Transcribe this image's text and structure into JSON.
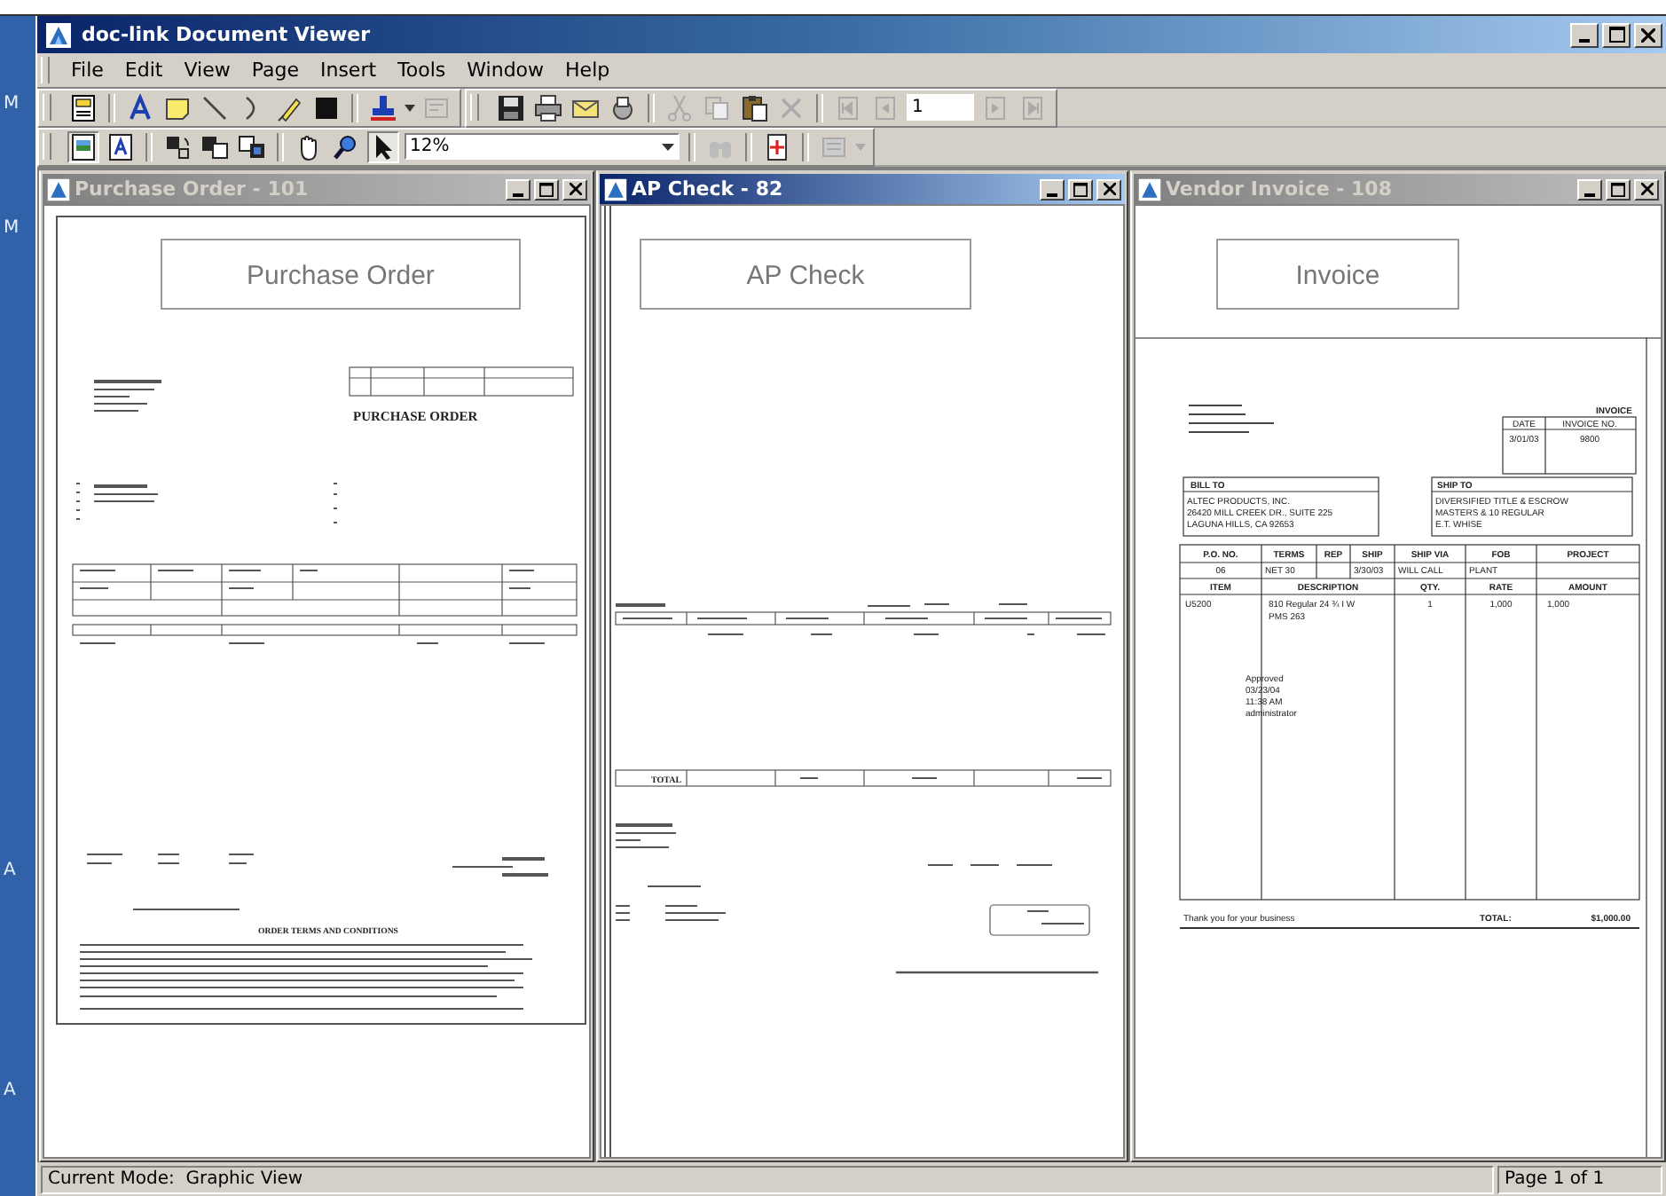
{
  "window": {
    "title": "doc-link Document Viewer"
  },
  "desktop_labels": [
    "M",
    "M",
    "A",
    "A"
  ],
  "menu": [
    "File",
    "Edit",
    "View",
    "Page",
    "Insert",
    "Tools",
    "Window",
    "Help"
  ],
  "toolbar": {
    "page_number": "1",
    "zoom": "12%"
  },
  "documents": [
    {
      "kind": "purchase_order",
      "title": "Purchase Order - 101",
      "active": false,
      "header": "Purchase Order",
      "heading": "PURCHASE ORDER",
      "terms_heading": "ORDER TERMS AND CONDITIONS"
    },
    {
      "kind": "check",
      "title": "AP Check - 82",
      "active": true,
      "header": "AP Check",
      "total_label": "TOTAL"
    },
    {
      "kind": "invoice",
      "title": "Vendor Invoice - 108",
      "active": false,
      "header": "Invoice",
      "heading": "INVOICE",
      "date_label": "DATE",
      "number_label": "INVOICE NO.",
      "date": "3/01/03",
      "number": "9800",
      "bill_to": {
        "label": "BILL TO",
        "lines": [
          "ALTEC PRODUCTS, INC.",
          "26420 MILL CREEK DR., SUITE 225",
          "LAGUNA HILLS, CA 92653"
        ]
      },
      "ship_to": {
        "label": "SHIP TO",
        "lines": [
          "DIVERSIFIED TITLE & ESCROW",
          "MASTERS & 10 REGULAR",
          "E.T. WHISE"
        ]
      },
      "terms_columns": [
        {
          "label": "P.O. NO.",
          "value": "06"
        },
        {
          "label": "TERMS",
          "value": "NET 30"
        },
        {
          "label": "REP"
        },
        {
          "label": "SHIP",
          "value": "3/30/03"
        },
        {
          "label": "SHIP VIA",
          "value": "WILL CALL"
        },
        {
          "label": "FOB",
          "value": "PLANT"
        },
        {
          "label": "PROJECT"
        }
      ],
      "item_columns": [
        "ITEM",
        "DESCRIPTION",
        "QTY.",
        "RATE",
        "AMOUNT"
      ],
      "items": [
        {
          "item": "U5200",
          "description": [
            "810 Regular 24 ¾ I W",
            "PMS 263"
          ],
          "qty": "1",
          "rate": "1,000",
          "amount": "1,000"
        }
      ],
      "stamp": [
        "Approved",
        "03/23/04",
        "11:38 AM",
        "administrator"
      ],
      "footer": "Thank you for your business",
      "total_label": "TOTAL:",
      "total": "$1,000.00"
    }
  ],
  "status_bar": {
    "mode": "Current Mode:  Graphic View",
    "page": "Page 1 of 1"
  }
}
